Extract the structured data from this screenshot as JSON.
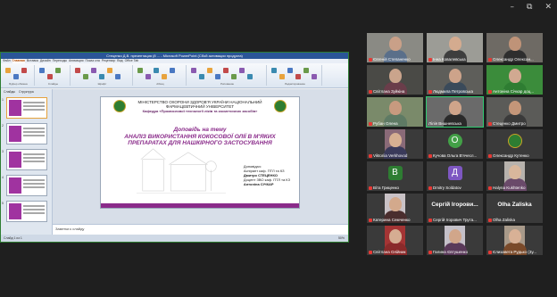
{
  "window": {
    "minimize_glyph": "–",
    "maximize_glyph": "⧉",
    "close_glyph": "✕"
  },
  "share": {
    "ppt_title": "Стеценко Д.В. презентация (8 ... - Microsoft PowerPoint (Сбой активации продукта)",
    "tabs": [
      "Файл",
      "Главная",
      "Вставка",
      "Дизайн",
      "Переходы",
      "Анимация",
      "Показ сла",
      "Рецензир",
      "Вид",
      "Office Tab"
    ],
    "active_tab": "Главная",
    "ribbon_groups": [
      "Буфер обмена",
      "Слайды",
      "Шрифт",
      "Абзац",
      "Рисование",
      "Редактирование"
    ],
    "thumb_tabs": [
      "Слайды",
      "Структура"
    ],
    "thumb_numbers": [
      "1",
      "2",
      "3",
      "4",
      "5"
    ],
    "slide": {
      "ministry": "МІНІСТЕРСТВО ОХОРОНИ ЗДОРОВ'Я УКРАЇНИ НАЦІОНАЛЬНИЙ ФАРМАЦЕВТИЧНИЙ УНІВЕРСИТЕТ",
      "department": "Кафедра «Промислової технології ліків та косметичних засобів»",
      "lead": "Доповідь на тему",
      "topic": "АНАЛІЗ ВИКОРИСТАННЯ КОКОСОВОЇ ОЛІЇ В М'ЯКИХ ПРЕПАРАТАХ ДЛЯ НАШКІРНОГО ЗАСТОСУВАННЯ",
      "rep_lines": [
        "Доповідач:",
        "Аспірант каф. ПТЛ та КЗ",
        "Дмитро СТЕЦЕНКО",
        "Доцент ЗВО каф. ПТЛ та КЗ",
        "Антоніна СІЧКАР"
      ]
    },
    "notes": "Заметки к слайду",
    "status": "Слайд 1 из 1",
    "zoom": "50%"
  },
  "participants": [
    {
      "name": "Євгеній Степаненко",
      "kind": "video",
      "skin": "#c9a088",
      "shirt": "#5a6f8a",
      "bg": "#8a8a84",
      "muted": true
    },
    {
      "name": "Інна Ковалевська",
      "kind": "video",
      "skin": "#d4ab8f",
      "shirt": "#3e3e3e",
      "bg": "#9c9c96",
      "muted": true
    },
    {
      "name": "Олександр Олексан...",
      "kind": "video",
      "skin": "#bf9378",
      "shirt": "#2e2e2e",
      "bg": "#6e6a64",
      "muted": true
    },
    {
      "name": "Світлана Зуйкіна",
      "kind": "video",
      "skin": "#caa48c",
      "shirt": "#6a3d4a",
      "bg": "#4a4a46",
      "muted": true
    },
    {
      "name": "Людмила Петровська",
      "kind": "video",
      "skin": "#cda38a",
      "shirt": "#3a4a5a",
      "bg": "#5e5e5a",
      "muted": true
    },
    {
      "name": "Антоніна Січкар доц...",
      "kind": "video",
      "skin": "#d1a991",
      "shirt": "#2e7d32",
      "bg": "#3b8c3b",
      "muted": true
    },
    {
      "name": "Рубан Олена",
      "kind": "video",
      "skin": "#c79a7f",
      "shirt": "#5e7a64",
      "bg": "#7a8a6a",
      "muted": true
    },
    {
      "name": "Лілія Вишневська",
      "kind": "video",
      "skin": "#cfa48a",
      "shirt": "#2a2a2a",
      "bg": "#6a6a6a",
      "muted": false,
      "active": true
    },
    {
      "name": "Стеценко Дмитро",
      "kind": "video",
      "skin": "#c49679",
      "shirt": "#3a3a3a",
      "bg": "#5b5b58",
      "muted": true
    },
    {
      "name": "Viktoriia Verkhovod",
      "kind": "photo",
      "skin": "#d7b092",
      "shirt": "#3a3a5a",
      "bg": "#8a6a78",
      "muted": true
    },
    {
      "name": "Кучова Ольга В'ячесл...",
      "kind": "letter",
      "letter": "О",
      "color": "#43a047",
      "round": true,
      "muted": true
    },
    {
      "name": "Олександр Кутенко",
      "kind": "logo",
      "color": "#2e7d32",
      "muted": true
    },
    {
      "name": "Віта Гриценко",
      "kind": "letter",
      "letter": "В",
      "color": "#2e7d32",
      "round": false,
      "muted": true
    },
    {
      "name": "Dmitry Soldatov",
      "kind": "letter",
      "letter": "Д",
      "color": "#7e57c2",
      "round": false,
      "muted": true
    },
    {
      "name": "Halyna Kukhtenko",
      "kind": "photo",
      "skin": "#d9b79c",
      "shirt": "#6a4a6a",
      "bg": "#b7b2ad",
      "muted": true
    },
    {
      "name": "Катерина Семченко",
      "kind": "photo",
      "skin": "#d3a98c",
      "shirt": "#4a2e2e",
      "bg": "#c9c2c6",
      "muted": true
    },
    {
      "name": "Сергій Ігорович Трута...",
      "kind": "text",
      "big": "Сергій Ігорови...",
      "muted": true
    },
    {
      "name": "Olha Zaliska",
      "kind": "text",
      "big": "Olha Zaliska",
      "muted": true
    },
    {
      "name": "Світлана Олійник",
      "kind": "photo",
      "skin": "#d5ad92",
      "shirt": "#8a2a2a",
      "bg": "#a43434",
      "muted": true
    },
    {
      "name": "Галина Євтушенко",
      "kind": "photo",
      "skin": "#d1a68a",
      "shirt": "#5a3a5a",
      "bg": "#c4c0c8",
      "muted": true
    },
    {
      "name": "Єлизавета Рудько (Зу...",
      "kind": "photo",
      "skin": "#d8b196",
      "shirt": "#7a4a2a",
      "bg": "#a89a8a",
      "muted": true
    }
  ]
}
